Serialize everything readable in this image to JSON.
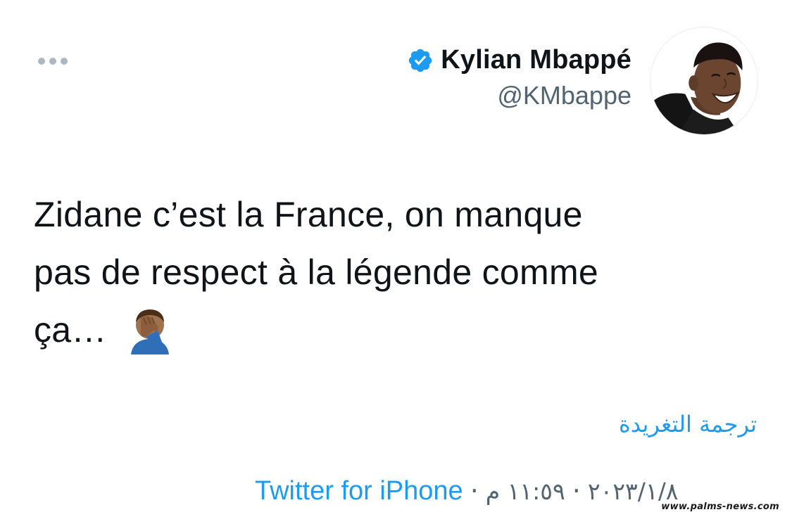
{
  "tweet": {
    "author": {
      "name": "Kylian Mbappé",
      "handle": "@KMbappe",
      "verified": true,
      "avatar_icon": "profile-photo"
    },
    "text_lines": [
      "Zidane c’est la France, on manque",
      "pas de respect à la légende comme",
      "ça… "
    ],
    "emoji": "face-palm-icon",
    "translate_label": "ترجمة التغريدة",
    "meta": {
      "source": "Twitter for iPhone",
      "separator": "·",
      "time": "١١:٥٩ م",
      "date": "٢٠٢٣/١/٨"
    },
    "colors": {
      "link": "#1d9bf0",
      "secondary_text": "#536471",
      "primary_text": "#0f1419",
      "verified_badge": "#1d9bf0"
    }
  },
  "watermark": "www.palms-news.com"
}
